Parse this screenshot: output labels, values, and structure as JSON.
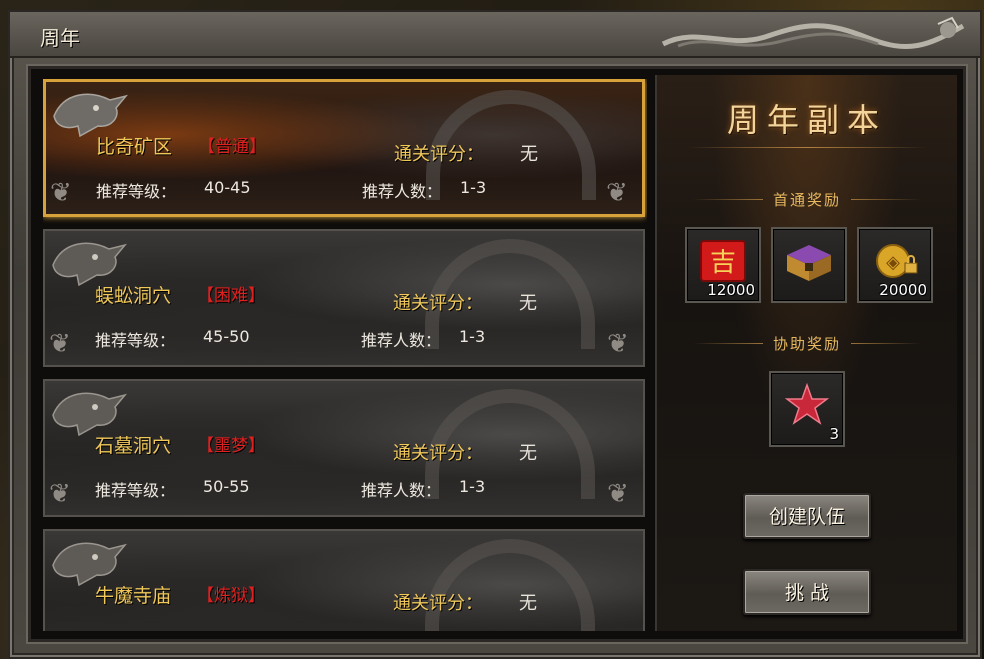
{
  "window": {
    "title": "周年"
  },
  "dungeons": [
    {
      "name": "比奇矿区",
      "difficulty": "【普通】",
      "clear_label": "通关评分：",
      "clear_value": "无",
      "level_label": "推荐等级：",
      "level_value": "40-45",
      "players_label": "推荐人数：",
      "players_value": "1-3",
      "selected": true
    },
    {
      "name": "蜈蚣洞穴",
      "difficulty": "【困难】",
      "clear_label": "通关评分：",
      "clear_value": "无",
      "level_label": "推荐等级：",
      "level_value": "45-50",
      "players_label": "推荐人数：",
      "players_value": "1-3",
      "selected": false
    },
    {
      "name": "石墓洞穴",
      "difficulty": "【噩梦】",
      "clear_label": "通关评分：",
      "clear_value": "无",
      "level_label": "推荐等级：",
      "level_value": "50-55",
      "players_label": "推荐人数：",
      "players_value": "1-3",
      "selected": false
    },
    {
      "name": "牛魔寺庙",
      "difficulty": "【炼狱】",
      "clear_label": "通关评分：",
      "clear_value": "无",
      "selected": false
    }
  ],
  "side": {
    "title": "周年副本",
    "first_clear_title": "首通奖励",
    "first_clear_rewards": [
      {
        "icon": "red-envelope-icon",
        "count": "12000"
      },
      {
        "icon": "treasure-chest-icon",
        "count": ""
      },
      {
        "icon": "locked-gold-coin-icon",
        "count": "20000"
      }
    ],
    "assist_title": "协助奖励",
    "assist_rewards": [
      {
        "icon": "red-star-gem-icon",
        "count": "3"
      }
    ],
    "create_team_label": "创建队伍",
    "challenge_label": "挑 战"
  },
  "colors": {
    "gold_text": "#f0c85a",
    "difficulty_red": "#e02020",
    "selected_border": "#d8a23a"
  }
}
